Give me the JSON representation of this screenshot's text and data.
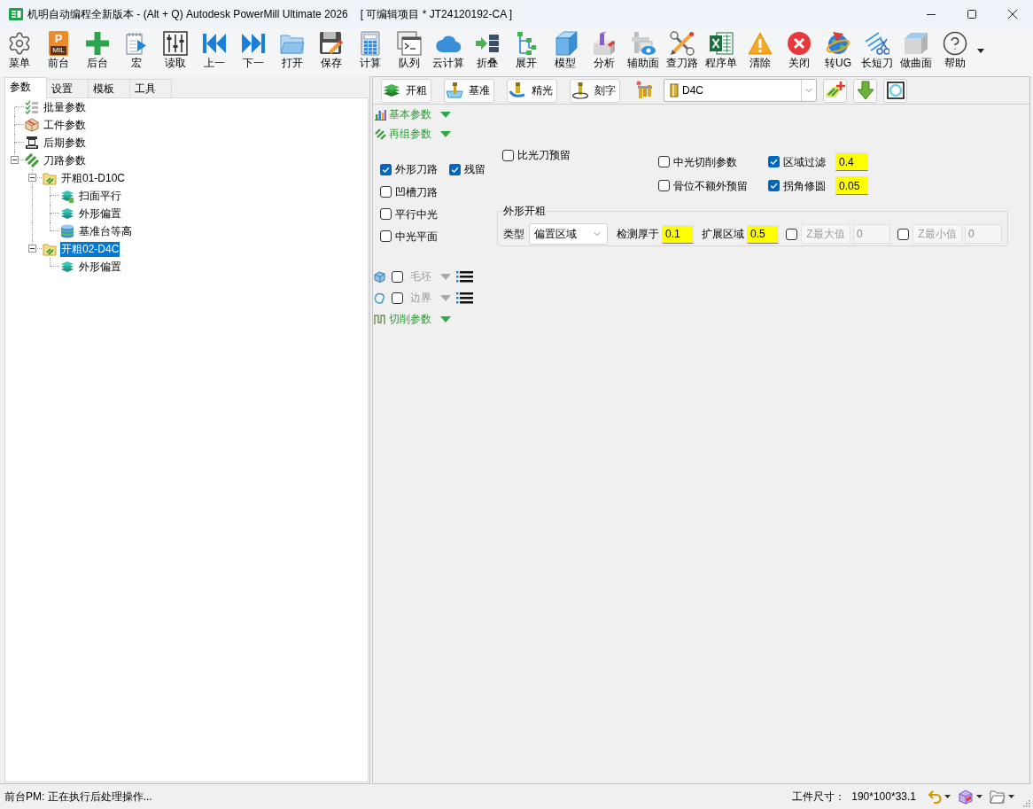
{
  "window": {
    "title": "机明自动编程全新版本 - (Alt + Q) Autodesk PowerMill Ultimate 2026",
    "project": "[ 可编辑项目 * JT24120192-CA ]"
  },
  "toolbar": [
    {
      "label": "菜单",
      "kind": "gear"
    },
    {
      "label": "前台",
      "kind": "app-tile",
      "icon_text": "P",
      "icon_subtext": "MIL"
    },
    {
      "label": "后台",
      "kind": "plus"
    },
    {
      "label": "宏",
      "kind": "macro"
    },
    {
      "label": "读取",
      "kind": "sliders"
    },
    {
      "label": "上一",
      "kind": "previous"
    },
    {
      "label": "下一",
      "kind": "next"
    },
    {
      "label": "打开",
      "kind": "folder"
    },
    {
      "label": "保存",
      "kind": "save"
    },
    {
      "label": "计算",
      "kind": "calculator"
    },
    {
      "label": "队列",
      "kind": "terminal"
    },
    {
      "label": "云计算",
      "kind": "cloud"
    },
    {
      "label": "折叠",
      "kind": "collapse"
    },
    {
      "label": "展开",
      "kind": "expand"
    },
    {
      "label": "模型",
      "kind": "cube"
    },
    {
      "label": "分析",
      "kind": "analysis"
    },
    {
      "label": "辅助面",
      "kind": "surface-view"
    },
    {
      "label": "查刀路",
      "kind": "tools"
    },
    {
      "label": "程序单",
      "kind": "spreadsheet"
    },
    {
      "label": "清除",
      "kind": "warning"
    },
    {
      "label": "关闭",
      "kind": "close"
    },
    {
      "label": "转UG",
      "kind": "globe"
    },
    {
      "label": "长短刀",
      "kind": "cutter"
    },
    {
      "label": "做曲面",
      "kind": "block"
    },
    {
      "label": "帮助",
      "kind": "help"
    }
  ],
  "left_panel": {
    "tabs": [
      {
        "label": "参数",
        "selected": true
      },
      {
        "label": "设置",
        "selected": false
      },
      {
        "label": "模板",
        "selected": false
      },
      {
        "label": "工具",
        "selected": false
      }
    ],
    "tree": [
      {
        "label": "批量参数",
        "kind": "checklist",
        "selected": false
      },
      {
        "label": "工件参数",
        "kind": "package",
        "selected": false
      },
      {
        "label": "后期参数",
        "kind": "machine",
        "selected": false
      },
      {
        "label": "刀路参数",
        "kind": "stripes",
        "selected": false,
        "expanded": true,
        "children": [
          {
            "label": "开粗01-D10C",
            "kind": "folder",
            "selected": false,
            "expanded": true,
            "children": [
              {
                "label": "扫面平行",
                "kind": "layers-plus",
                "selected": false
              },
              {
                "label": "外形偏置",
                "kind": "layers",
                "selected": false
              },
              {
                "label": "基准台等高",
                "kind": "cylinder",
                "selected": false
              }
            ]
          },
          {
            "label": "开粗02-D4C",
            "kind": "folder",
            "selected": true,
            "expanded": true,
            "children": [
              {
                "label": "外形偏置",
                "kind": "layers",
                "selected": false
              }
            ]
          }
        ]
      }
    ]
  },
  "right_panel": {
    "strategy_buttons": [
      {
        "label": "开粗",
        "kind": "rough"
      },
      {
        "label": "基准",
        "kind": "datum"
      },
      {
        "label": "精光",
        "kind": "finish"
      },
      {
        "label": "刻字",
        "kind": "engrave"
      }
    ],
    "tool": {
      "value": "D4C"
    },
    "tool_buttons": [
      {
        "kind": "add-toolpath"
      },
      {
        "kind": "download"
      },
      {
        "kind": "ring"
      }
    ],
    "section_headers": [
      {
        "label": "基本参数",
        "kind": "basic"
      },
      {
        "label": "再组参数",
        "kind": "regroup"
      }
    ],
    "options_left": [
      [
        {
          "label": "外形刀路",
          "checked": true
        },
        {
          "label": "残留",
          "checked": true
        }
      ],
      [
        {
          "label": "凹槽刀路",
          "checked": false
        }
      ],
      [
        {
          "label": "平行中光",
          "checked": false
        }
      ],
      [
        {
          "label": "中光平面",
          "checked": false
        }
      ]
    ],
    "option_top": {
      "label": "比光刀预留",
      "checked": false
    },
    "options_right": [
      [
        {
          "label": "中光切削参数",
          "checked": false
        },
        {
          "label": "区域过滤",
          "checked": true,
          "value": "0.4"
        }
      ],
      [
        {
          "label": "骨位不额外预留",
          "checked": false
        },
        {
          "label": "拐角修圆",
          "checked": true,
          "value": "0.05"
        }
      ]
    ],
    "outline_rough": {
      "title": "外形开粗",
      "type_label": "类型",
      "type_value": "偏置区域",
      "fields": [
        {
          "label": "检测厚于",
          "value": "0.1"
        },
        {
          "label": "扩展区域",
          "value": "0.5"
        }
      ],
      "limits": [
        {
          "label": "Z最大值",
          "checked": false,
          "value": "0"
        },
        {
          "label": "Z最小值",
          "checked": false,
          "value": "0"
        }
      ]
    },
    "sections": [
      {
        "label": "毛坯",
        "kind": "stock",
        "checked": false
      },
      {
        "label": "边界",
        "kind": "boundary",
        "checked": false
      },
      {
        "label": "切削参数",
        "kind": "cutting"
      }
    ]
  },
  "status_bar": {
    "message": "前台PM: 正在执行后处理操作...",
    "size_label": "工件尺寸：",
    "size_value": "190*100*33.1",
    "tools": [
      {
        "kind": "undo"
      },
      {
        "kind": "view-cube"
      },
      {
        "kind": "folder"
      }
    ]
  }
}
